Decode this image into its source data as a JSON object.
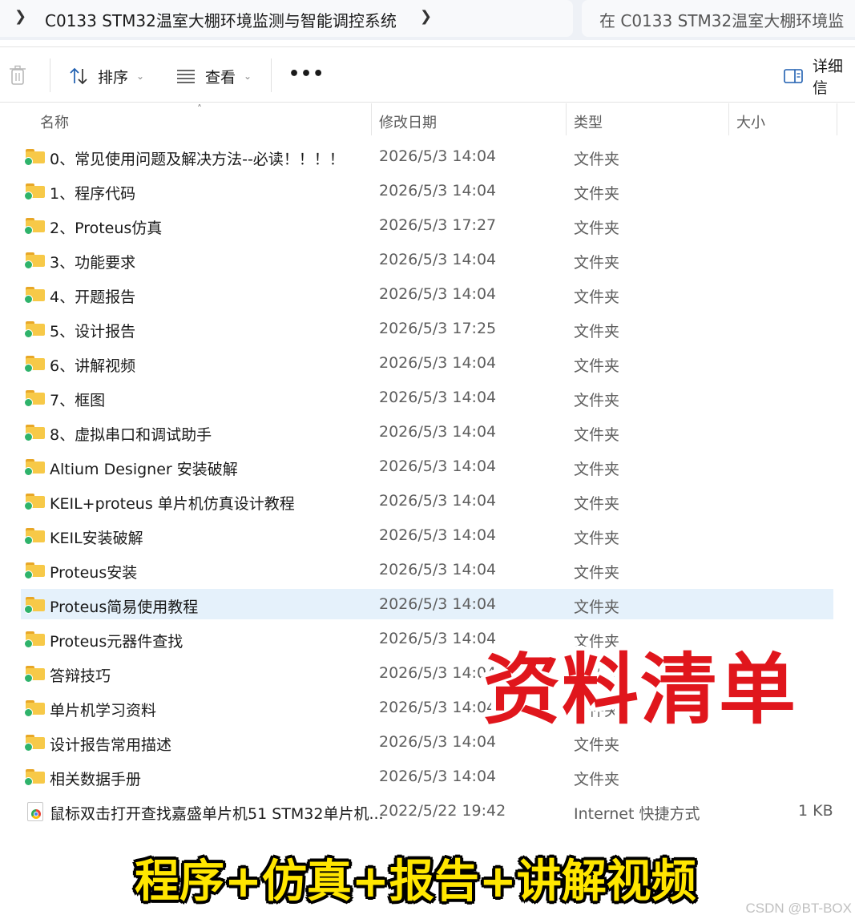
{
  "address_bar": {
    "path": "C0133 STM32温室大棚环境监测与智能调控系统",
    "search_placeholder": "在 C0133 STM32温室大棚环境监"
  },
  "toolbar": {
    "sort_label": "排序",
    "view_label": "查看",
    "more_label": "•••",
    "details_label": "详细信"
  },
  "columns": {
    "name": "名称",
    "date": "修改日期",
    "type": "类型",
    "size": "大小"
  },
  "files": [
    {
      "name": "0、常见使用问题及解决方法--必读！！！！",
      "date": "2026/5/3 14:04",
      "type": "文件夹",
      "size": "",
      "icon": "folder-icon"
    },
    {
      "name": "1、程序代码",
      "date": "2026/5/3 14:04",
      "type": "文件夹",
      "size": "",
      "icon": "folder-icon"
    },
    {
      "name": "2、Proteus仿真",
      "date": "2026/5/3 17:27",
      "type": "文件夹",
      "size": "",
      "icon": "folder-icon"
    },
    {
      "name": "3、功能要求",
      "date": "2026/5/3 14:04",
      "type": "文件夹",
      "size": "",
      "icon": "folder-icon"
    },
    {
      "name": "4、开题报告",
      "date": "2026/5/3 14:04",
      "type": "文件夹",
      "size": "",
      "icon": "folder-icon"
    },
    {
      "name": "5、设计报告",
      "date": "2026/5/3 17:25",
      "type": "文件夹",
      "size": "",
      "icon": "folder-icon"
    },
    {
      "name": "6、讲解视频",
      "date": "2026/5/3 14:04",
      "type": "文件夹",
      "size": "",
      "icon": "folder-icon"
    },
    {
      "name": "7、框图",
      "date": "2026/5/3 14:04",
      "type": "文件夹",
      "size": "",
      "icon": "folder-icon"
    },
    {
      "name": "8、虚拟串口和调试助手",
      "date": "2026/5/3 14:04",
      "type": "文件夹",
      "size": "",
      "icon": "folder-icon"
    },
    {
      "name": "Altium Designer 安装破解",
      "date": "2026/5/3 14:04",
      "type": "文件夹",
      "size": "",
      "icon": "folder-icon"
    },
    {
      "name": "KEIL+proteus 单片机仿真设计教程",
      "date": "2026/5/3 14:04",
      "type": "文件夹",
      "size": "",
      "icon": "folder-icon"
    },
    {
      "name": "KEIL安装破解",
      "date": "2026/5/3 14:04",
      "type": "文件夹",
      "size": "",
      "icon": "folder-icon"
    },
    {
      "name": "Proteus安装",
      "date": "2026/5/3 14:04",
      "type": "文件夹",
      "size": "",
      "icon": "folder-icon"
    },
    {
      "name": "Proteus简易使用教程",
      "date": "2026/5/3 14:04",
      "type": "文件夹",
      "size": "",
      "icon": "folder-icon",
      "selected": true
    },
    {
      "name": "Proteus元器件查找",
      "date": "2026/5/3 14:04",
      "type": "文件夹",
      "size": "",
      "icon": "folder-icon"
    },
    {
      "name": "答辩技巧",
      "date": "2026/5/3 14:04",
      "type": "文件夹",
      "size": "",
      "icon": "folder-icon"
    },
    {
      "name": "单片机学习资料",
      "date": "2026/5/3 14:04",
      "type": "文件夹",
      "size": "",
      "icon": "folder-icon"
    },
    {
      "name": "设计报告常用描述",
      "date": "2026/5/3 14:04",
      "type": "文件夹",
      "size": "",
      "icon": "folder-icon"
    },
    {
      "name": "相关数据手册",
      "date": "2026/5/3 14:04",
      "type": "文件夹",
      "size": "",
      "icon": "folder-icon"
    },
    {
      "name": "鼠标双击打开查找嘉盛单片机51 STM32单片机...",
      "date": "2022/5/22 19:42",
      "type": "Internet 快捷方式",
      "size": "1 KB",
      "icon": "internet-shortcut-icon"
    }
  ],
  "overlays": {
    "red_banner": "资料清单",
    "yellow_banner": "程序+仿真+报告+讲解视频",
    "watermark": "CSDN @BT-BOX"
  },
  "colors": {
    "selection": "#e5f1fb",
    "folder": "#f7c948",
    "sync_badge": "#2fb36b",
    "red_banner": "#e0161c",
    "yellow_banner": "#ffe600"
  }
}
